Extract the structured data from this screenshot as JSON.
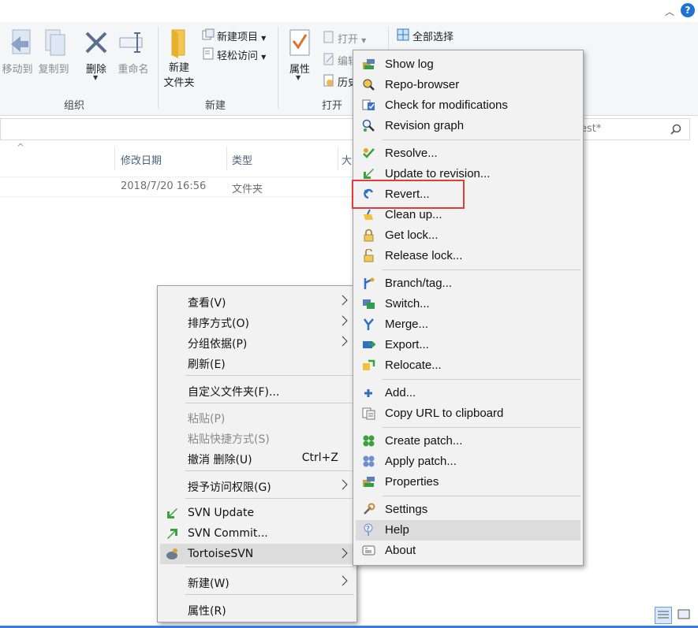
{
  "ribbon": {
    "move_to": "移动到",
    "copy_to": "复制到",
    "delete": "删除",
    "rename": "重命名",
    "new_folder_line1": "新建",
    "new_folder_line2": "文件夹",
    "new_item": "新建项目",
    "easy_access": "轻松访问",
    "properties": "属性",
    "open": "打开",
    "edit": "编辑",
    "history": "历史",
    "select_all": "全部选择",
    "groups": {
      "organize": "组织",
      "new": "新建",
      "open": "打开"
    }
  },
  "search": {
    "placeholder": "est*"
  },
  "file_list": {
    "columns": [
      "修改日期",
      "类型",
      "大"
    ],
    "rows": [
      {
        "modified": "2018/7/20 16:56",
        "type": "文件夹"
      }
    ]
  },
  "context_menu": {
    "items": [
      {
        "label": "查看(V)",
        "submenu": true
      },
      {
        "label": "排序方式(O)",
        "submenu": true
      },
      {
        "label": "分组依据(P)",
        "submenu": true
      },
      {
        "label": "刷新(E)"
      },
      {
        "label": "自定义文件夹(F)..."
      },
      {
        "label": "粘贴(P)",
        "disabled": true
      },
      {
        "label": "粘贴快捷方式(S)",
        "disabled": true
      },
      {
        "label": "撤消 删除(U)",
        "accel": "Ctrl+Z"
      },
      {
        "label": "授予访问权限(G)",
        "submenu": true
      },
      {
        "label": "SVN Update"
      },
      {
        "label": "SVN Commit..."
      },
      {
        "label": "TortoiseSVN",
        "submenu": true,
        "highlighted": true
      },
      {
        "label": "新建(W)",
        "submenu": true
      },
      {
        "label": "属性(R)"
      }
    ]
  },
  "svn_menu": {
    "items": [
      {
        "label": "Show log",
        "icon": "show-log-icon"
      },
      {
        "label": "Repo-browser",
        "icon": "repo-browser-icon"
      },
      {
        "label": "Check for modifications",
        "icon": "check-modifications-icon"
      },
      {
        "label": "Revision graph",
        "icon": "revision-graph-icon"
      },
      {
        "label": "Resolve...",
        "icon": "resolve-icon"
      },
      {
        "label": "Update to revision...",
        "icon": "update-to-revision-icon"
      },
      {
        "label": "Revert...",
        "icon": "revert-icon",
        "boxed": true
      },
      {
        "label": "Clean up...",
        "icon": "cleanup-icon"
      },
      {
        "label": "Get lock...",
        "icon": "lock-icon"
      },
      {
        "label": "Release lock...",
        "icon": "unlock-icon"
      },
      {
        "label": "Branch/tag...",
        "icon": "branch-icon"
      },
      {
        "label": "Switch...",
        "icon": "switch-icon"
      },
      {
        "label": "Merge...",
        "icon": "merge-icon"
      },
      {
        "label": "Export...",
        "icon": "export-icon"
      },
      {
        "label": "Relocate...",
        "icon": "relocate-icon"
      },
      {
        "label": "Add...",
        "icon": "add-icon"
      },
      {
        "label": "Copy URL to clipboard",
        "icon": "copy-url-icon"
      },
      {
        "label": "Create patch...",
        "icon": "create-patch-icon"
      },
      {
        "label": "Apply patch...",
        "icon": "apply-patch-icon"
      },
      {
        "label": "Properties",
        "icon": "properties-icon"
      },
      {
        "label": "Settings",
        "icon": "settings-icon"
      },
      {
        "label": "Help",
        "icon": "help-icon",
        "highlighted": true
      },
      {
        "label": "About",
        "icon": "about-icon"
      }
    ]
  },
  "accel_arrow": "›"
}
